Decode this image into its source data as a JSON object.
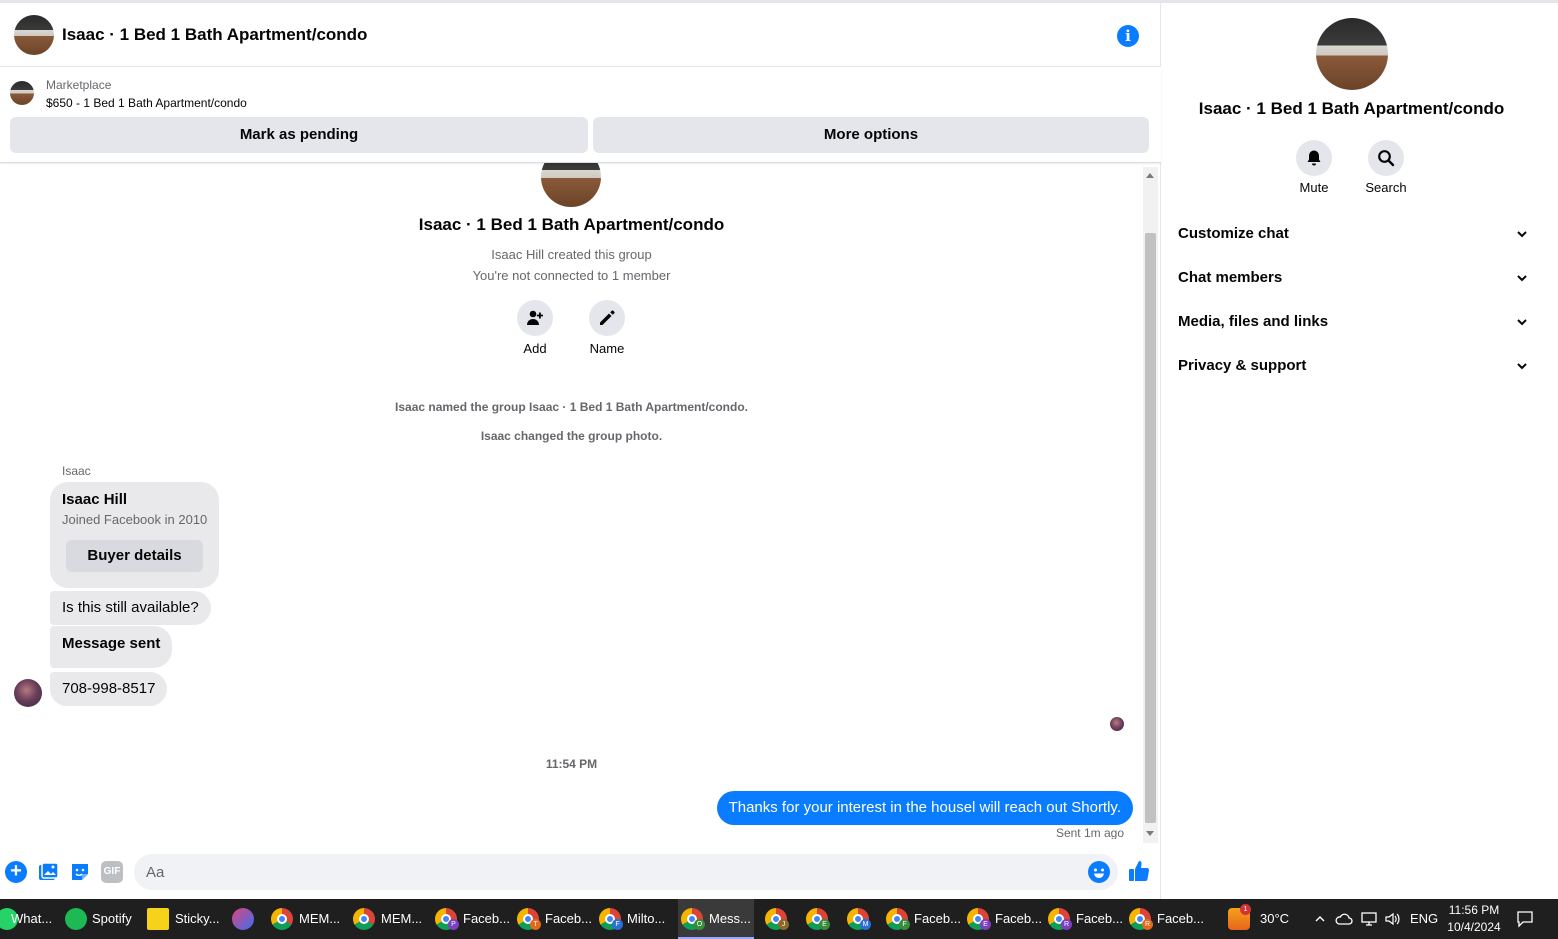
{
  "header": {
    "title": "Isaac · 1 Bed 1 Bath Apartment/condo",
    "info_icon": "info-icon"
  },
  "marketplace": {
    "label": "Marketplace",
    "listing": "$650 - 1 Bed 1 Bath Apartment/condo",
    "mark_pending": "Mark as pending",
    "more_options": "More options"
  },
  "thread": {
    "group_name": "Isaac · 1 Bed 1 Bath Apartment/condo",
    "created": "Isaac Hill created this group",
    "connection": "You're not connected to 1 member",
    "add_label": "Add",
    "name_label": "Name",
    "system_messages": [
      "Isaac named the group Isaac · 1 Bed 1 Bath Apartment/condo.",
      "Isaac changed the group photo."
    ],
    "sender": "Isaac",
    "card": {
      "name": "Isaac Hill",
      "subtitle": "Joined Facebook in 2010",
      "button": "Buyer details"
    },
    "incoming": [
      "Is this still available?",
      "Message sent",
      "708-998-8517"
    ],
    "timestamp": "11:54 PM",
    "outgoing": "Thanks for your interest in the housel will reach out Shortly.",
    "sent_status": "Sent 1m ago"
  },
  "composer": {
    "placeholder": "Aa",
    "gif_label": "GIF"
  },
  "sidebar": {
    "title": "Isaac · 1 Bed 1 Bath Apartment/condo",
    "mute": "Mute",
    "search": "Search",
    "sections": [
      "Customize chat",
      "Chat members",
      "Media, files and links",
      "Privacy & support"
    ]
  },
  "taskbar": {
    "items": [
      "What...",
      "Spotify",
      "Sticky...",
      "MEM...",
      "MEM...",
      "Faceb...",
      "Faceb...",
      "Milto...",
      "Mess...",
      "Faceb...",
      "Faceb...",
      "Faceb...",
      "Faceb..."
    ],
    "badges": [
      "P",
      "T",
      "F",
      "O",
      "J",
      "E",
      "M",
      "F",
      "E",
      "R",
      "R"
    ],
    "weather_badge": "1",
    "weather": "30°C",
    "language": "ENG",
    "time": "11:56 PM",
    "date": "10/4/2024"
  },
  "colors": {
    "accent": "#0a7cff",
    "bubble_in": "#e9e9eb",
    "button_bg": "#e4e6eb",
    "taskbar": "#1f1f1f"
  }
}
